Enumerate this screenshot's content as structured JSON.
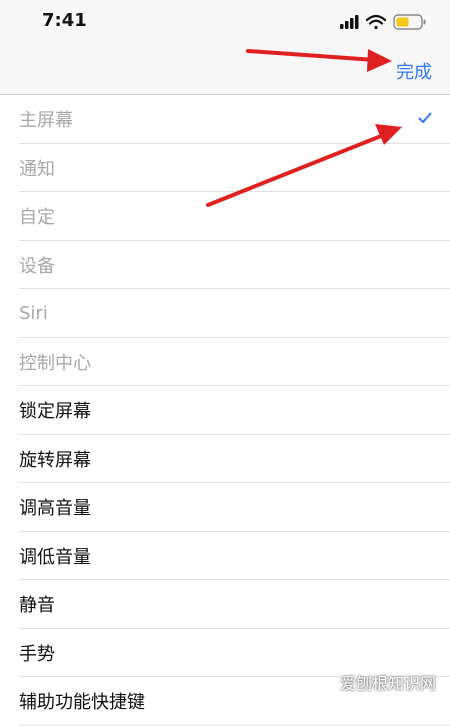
{
  "status_bar": {
    "time": "7:41",
    "icons": [
      "cellular-signal-icon",
      "wifi-icon",
      "battery-icon"
    ],
    "battery_color": "#f5c518"
  },
  "nav": {
    "done_label": "完成",
    "accent_color": "#3478f6"
  },
  "list": {
    "items": [
      {
        "label": "主屏幕",
        "muted": true,
        "checked": true
      },
      {
        "label": "通知",
        "muted": true,
        "checked": false
      },
      {
        "label": "自定",
        "muted": true,
        "checked": false
      },
      {
        "label": "设备",
        "muted": true,
        "checked": false
      },
      {
        "label": "Siri",
        "muted": true,
        "checked": false
      },
      {
        "label": "控制中心",
        "muted": true,
        "checked": false
      },
      {
        "label": "锁定屏幕",
        "muted": false,
        "checked": false
      },
      {
        "label": "旋转屏幕",
        "muted": false,
        "checked": false
      },
      {
        "label": "调高音量",
        "muted": false,
        "checked": false
      },
      {
        "label": "调低音量",
        "muted": false,
        "checked": false
      },
      {
        "label": "静音",
        "muted": false,
        "checked": false
      },
      {
        "label": "手势",
        "muted": false,
        "checked": false
      },
      {
        "label": "辅助功能快捷键",
        "muted": false,
        "checked": false
      }
    ]
  },
  "annotations": {
    "arrow_color": "#e02020"
  },
  "watermark": "爱刨根知识网"
}
